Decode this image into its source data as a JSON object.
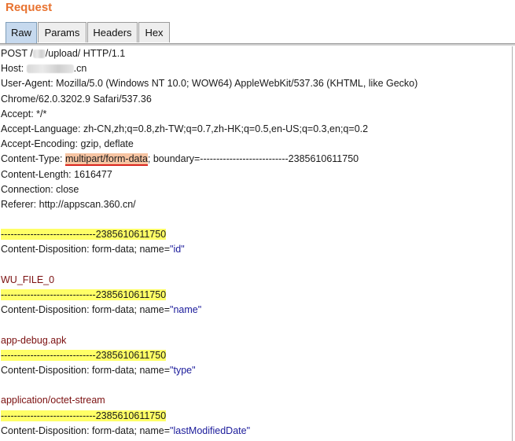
{
  "panel": {
    "title": "Request"
  },
  "tabs": [
    {
      "label": "Raw",
      "active": true
    },
    {
      "label": "Params",
      "active": false
    },
    {
      "label": "Headers",
      "active": false
    },
    {
      "label": "Hex",
      "active": false
    }
  ],
  "request": {
    "request_line_prefix": "POST /",
    "request_line_suffix": "/upload/ HTTP/1.1",
    "host_label": "Host: ",
    "host_suffix": ".cn",
    "user_agent": "User-Agent: Mozilla/5.0 (Windows NT 10.0; WOW64) AppleWebKit/537.36 (KHTML, like Gecko)",
    "user_agent_cont": "Chrome/62.0.3202.9 Safari/537.36",
    "accept": "Accept: */*",
    "accept_language": "Accept-Language: zh-CN,zh;q=0.8,zh-TW;q=0.7,zh-HK;q=0.5,en-US;q=0.3,en;q=0.2",
    "accept_encoding": "Accept-Encoding: gzip, deflate",
    "content_type_label": "Content-Type: ",
    "content_type_value": "multipart/form-data",
    "content_type_rest": "; boundary=---------------------------2385610611750",
    "content_length": "Content-Length: 1616477",
    "connection": "Connection: close",
    "referer": "Referer: http://appscan.360.cn/"
  },
  "body_parts": [
    {
      "boundary": "-----------------------------2385610611750",
      "disposition_prefix": "Content-Disposition: form-data; name=",
      "name": "\"id\"",
      "value": "WU_FILE_0"
    },
    {
      "boundary": "-----------------------------2385610611750",
      "disposition_prefix": "Content-Disposition: form-data; name=",
      "name": "\"name\"",
      "value": "app-debug.apk"
    },
    {
      "boundary": "-----------------------------2385610611750",
      "disposition_prefix": "Content-Disposition: form-data; name=",
      "name": "\"type\"",
      "value": "application/octet-stream"
    },
    {
      "boundary": "-----------------------------2385610611750",
      "disposition_prefix": "Content-Disposition: form-data; name=",
      "name": "\"lastModifiedDate\"",
      "value": ""
    }
  ]
}
